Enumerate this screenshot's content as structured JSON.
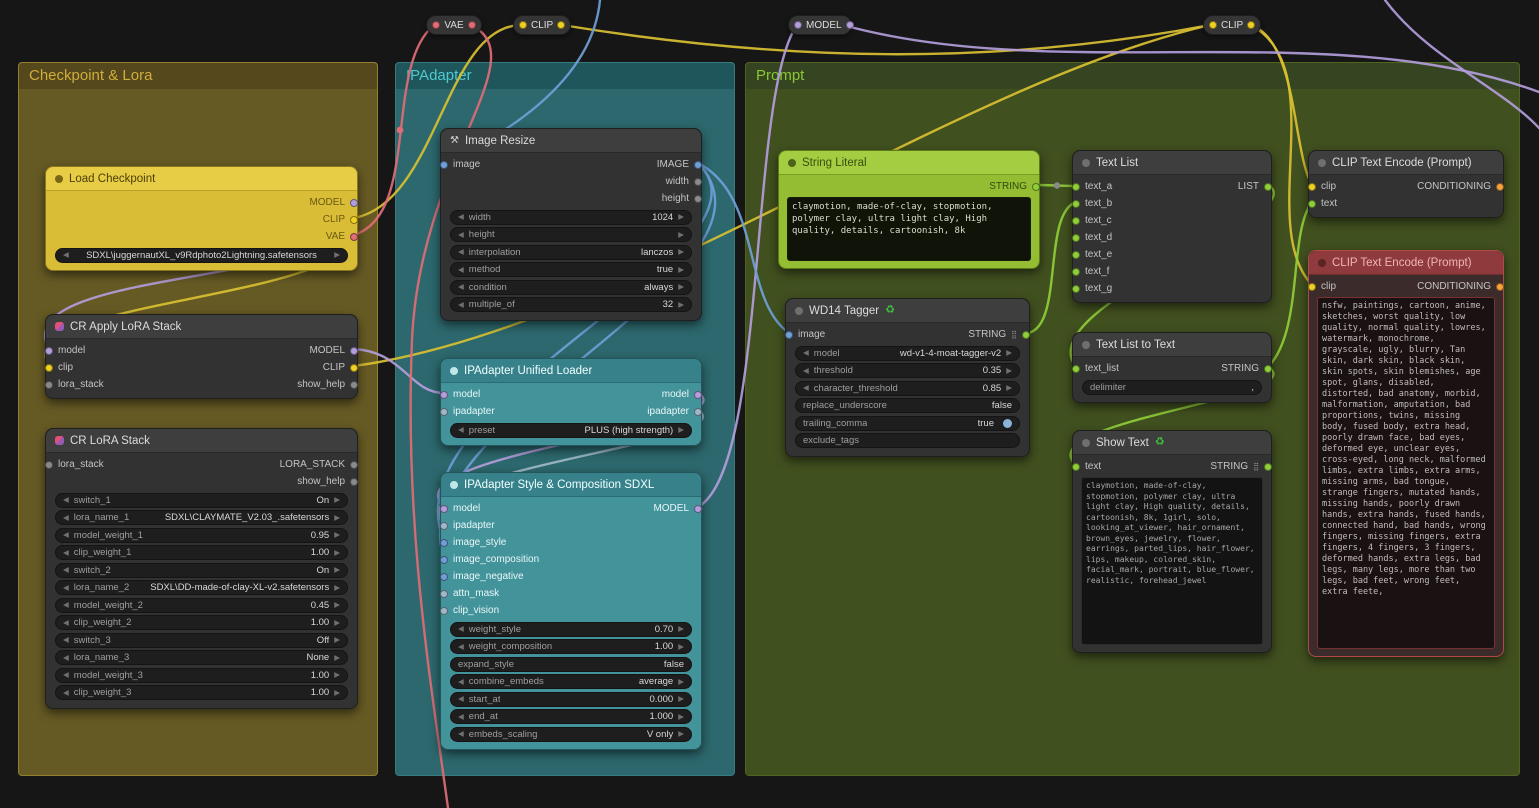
{
  "icons": {
    "wrench": "⚒",
    "recycle": "♻",
    "grid": "⣿"
  },
  "colors": {
    "model": "#b39ddb",
    "clip": "#efd023",
    "vae": "#e06c75",
    "image": "#6f9fd8",
    "string": "#8fce3a",
    "conditioning": "#f5a33a",
    "generic": "#8a8a8a",
    "ipadapter": "#9fb8c9",
    "group_checkpoint": "#665a24",
    "group_ipadapter": "#2c686d",
    "group_prompt": "#41501f"
  },
  "pills": [
    {
      "label": "VAE"
    },
    {
      "label": "CLIP"
    },
    {
      "label": "MODEL"
    },
    {
      "label": "CLIP"
    }
  ],
  "groups": {
    "checkpoint": {
      "title": "Checkpoint & Lora"
    },
    "ipadapter": {
      "title": "IPAdapter"
    },
    "prompt": {
      "title": "Prompt"
    }
  },
  "nodes": {
    "load_checkpoint": {
      "title": "Load Checkpoint",
      "outputs": [
        "MODEL",
        "CLIP",
        "VAE"
      ],
      "ckpt_name": "SDXL\\juggernautXL_v9Rdphoto2Lightning.safetensors"
    },
    "apply_lora": {
      "title": "CR Apply LoRA Stack",
      "inputs": [
        "model",
        "clip",
        "lora_stack"
      ],
      "outputs": [
        "MODEL",
        "CLIP",
        "show_help"
      ]
    },
    "lora_stack": {
      "title": "CR LoRA Stack",
      "inputs": [
        "lora_stack"
      ],
      "outputs": [
        "LORA_STACK",
        "show_help"
      ],
      "widgets": [
        {
          "label": "switch_1",
          "value": "On"
        },
        {
          "label": "lora_name_1",
          "value": "SDXL\\CLAYMATE_V2.03_.safetensors"
        },
        {
          "label": "model_weight_1",
          "value": "0.95"
        },
        {
          "label": "clip_weight_1",
          "value": "1.00"
        },
        {
          "label": "switch_2",
          "value": "On"
        },
        {
          "label": "lora_name_2",
          "value": "SDXL\\DD-made-of-clay-XL-v2.safetensors"
        },
        {
          "label": "model_weight_2",
          "value": "0.45"
        },
        {
          "label": "clip_weight_2",
          "value": "1.00"
        },
        {
          "label": "switch_3",
          "value": "Off"
        },
        {
          "label": "lora_name_3",
          "value": "None"
        },
        {
          "label": "model_weight_3",
          "value": "1.00"
        },
        {
          "label": "clip_weight_3",
          "value": "1.00"
        }
      ]
    },
    "image_resize": {
      "title": "Image Resize",
      "inputs": [
        "image"
      ],
      "outputs": [
        "IMAGE",
        "width",
        "height"
      ],
      "widgets": [
        {
          "label": "width",
          "value": "1024"
        },
        {
          "label": "height",
          "value": ""
        },
        {
          "label": "interpolation",
          "value": "lanczos"
        },
        {
          "label": "method",
          "value": "true"
        },
        {
          "label": "condition",
          "value": "always"
        },
        {
          "label": "multiple_of",
          "value": "32"
        }
      ]
    },
    "unified_loader": {
      "title": "IPAdapter Unified Loader",
      "inputs": [
        "model",
        "ipadapter"
      ],
      "outputs": [
        "model",
        "ipadapter"
      ],
      "widgets": [
        {
          "label": "preset",
          "value": "PLUS (high strength)"
        }
      ]
    },
    "style_comp": {
      "title": "IPAdapter Style & Composition SDXL",
      "inputs": [
        "model",
        "ipadapter",
        "image_style",
        "image_composition",
        "image_negative",
        "attn_mask",
        "clip_vision"
      ],
      "outputs": [
        "MODEL"
      ],
      "widgets": [
        {
          "label": "weight_style",
          "value": "0.70"
        },
        {
          "label": "weight_composition",
          "value": "1.00"
        },
        {
          "label": "expand_style",
          "value": "false"
        },
        {
          "label": "combine_embeds",
          "value": "average"
        },
        {
          "label": "start_at",
          "value": "0.000"
        },
        {
          "label": "end_at",
          "value": "1.000"
        },
        {
          "label": "embeds_scaling",
          "value": "V only"
        }
      ]
    },
    "string_literal": {
      "title": "String Literal",
      "outputs": [
        "STRING"
      ],
      "text": "claymotion, made-of-clay, stopmotion, polymer clay, ultra light clay, High quality, details, cartoonish, 8k"
    },
    "wd14": {
      "title": "WD14 Tagger",
      "inputs": [
        "image"
      ],
      "outputs": [
        "STRING"
      ],
      "widgets": [
        {
          "label": "model",
          "value": "wd-v1-4-moat-tagger-v2"
        },
        {
          "label": "threshold",
          "value": "0.35"
        },
        {
          "label": "character_threshold",
          "value": "0.85"
        },
        {
          "label": "replace_underscore",
          "value": "false"
        },
        {
          "label": "trailing_comma",
          "value": "true"
        },
        {
          "label": "exclude_tags",
          "value": ""
        }
      ]
    },
    "text_list": {
      "title": "Text List",
      "inputs": [
        "text_a",
        "text_b",
        "text_c",
        "text_d",
        "text_e",
        "text_f",
        "text_g"
      ],
      "outputs": [
        "LIST"
      ]
    },
    "text_list_to_text": {
      "title": "Text List to Text",
      "inputs": [
        "text_list"
      ],
      "outputs": [
        "STRING"
      ],
      "widgets": [
        {
          "label": "delimiter",
          "value": ","
        }
      ]
    },
    "show_text": {
      "title": "Show Text",
      "inputs": [
        "text"
      ],
      "outputs": [
        "STRING"
      ],
      "text": "claymotion, made-of-clay, stopmotion, polymer clay, ultra light clay, High quality, details, cartoonish, 8k, 1girl, solo, looking_at_viewer, hair_ornament, brown_eyes, jewelry, flower, earrings, parted_lips, hair_flower, lips, makeup, colored_skin, facial_mark, portrait, blue_flower, realistic, forehead_jewel"
    },
    "encode_pos": {
      "title": "CLIP Text Encode (Prompt)",
      "inputs": [
        "clip",
        "text"
      ],
      "outputs": [
        "CONDITIONING"
      ]
    },
    "encode_neg": {
      "title": "CLIP Text Encode (Prompt)",
      "inputs": [
        "clip"
      ],
      "outputs": [
        "CONDITIONING"
      ],
      "text": "nsfw, paintings, cartoon, anime, sketches, worst quality, low quality, normal quality, lowres, watermark, monochrome, grayscale, ugly, blurry, Tan skin, dark skin, black skin, skin spots, skin blemishes, age spot, glans, disabled, distorted, bad anatomy, morbid, malformation, amputation, bad proportions, twins, missing body, fused body, extra head, poorly drawn face, bad eyes, deformed eye, unclear eyes, cross-eyed, long neck, malformed limbs, extra limbs, extra arms, missing arms, bad tongue, strange fingers, mutated hands, missing hands, poorly drawn hands, extra hands, fused hands, connected hand, bad hands, wrong fingers, missing fingers, extra fingers, 4 fingers, 3 fingers, deformed hands, extra legs, bad legs, many legs, more than two legs, bad feet, wrong feet, extra feete,"
    }
  }
}
